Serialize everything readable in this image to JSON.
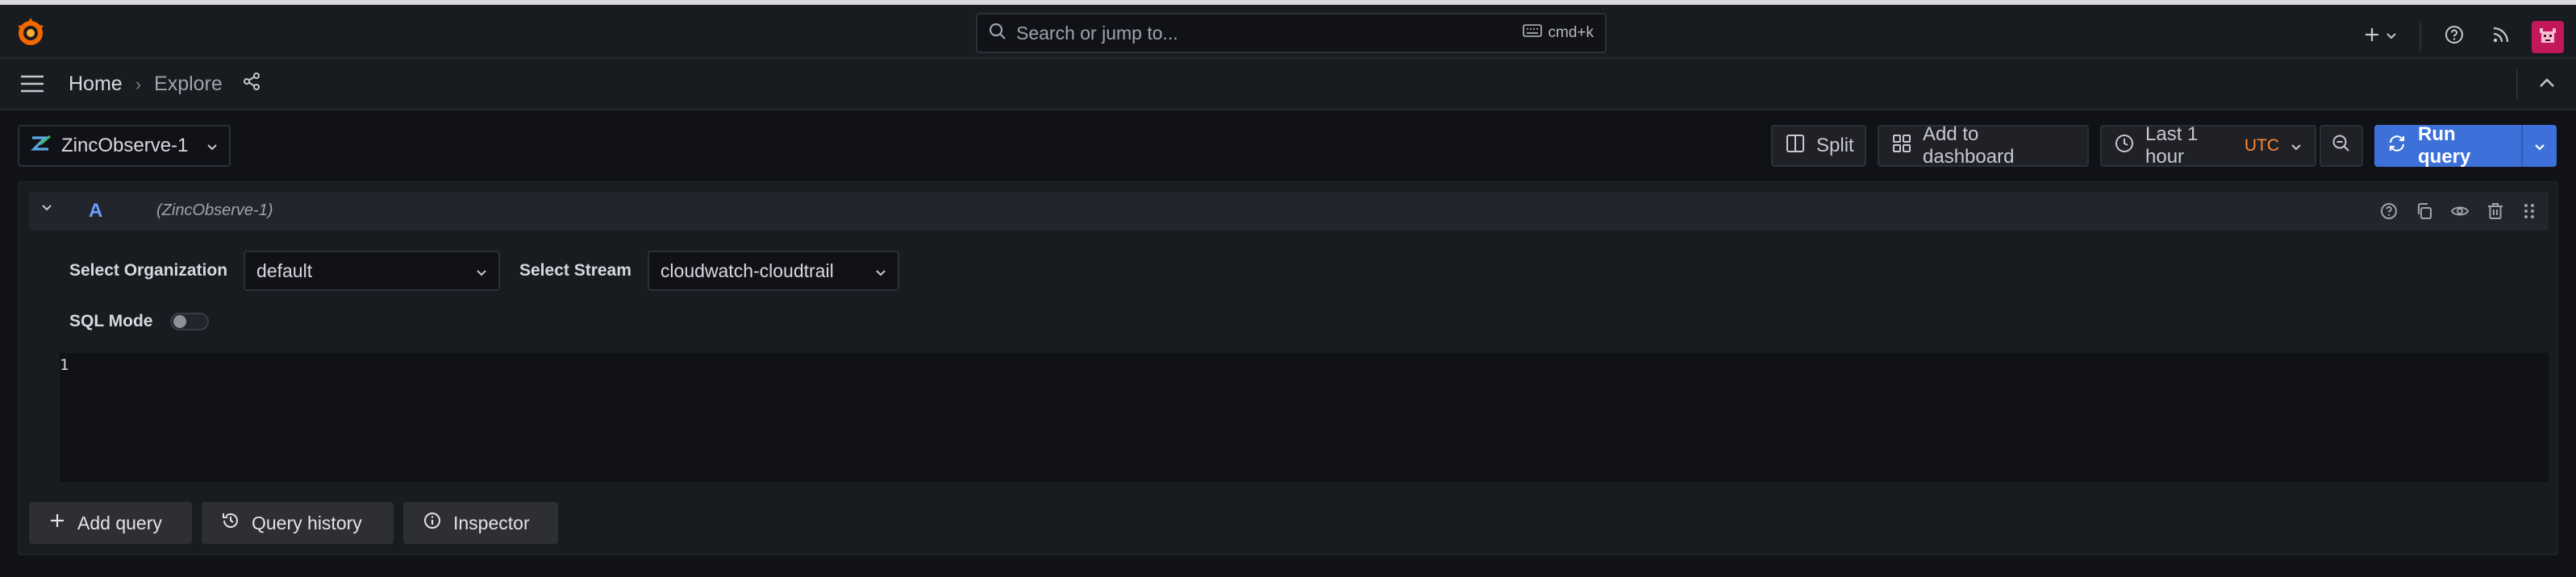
{
  "topbar": {
    "search_placeholder": "Search or jump to...",
    "search_shortcut": "cmd+k"
  },
  "breadcrumb": {
    "home": "Home",
    "separator": "›",
    "current": "Explore"
  },
  "toolbar": {
    "datasource": "ZincObserve-1",
    "split": "Split",
    "add_to_dashboard": "Add to dashboard",
    "time_range": "Last 1 hour",
    "timezone": "UTC",
    "run_query": "Run query"
  },
  "query": {
    "ref_id": "A",
    "datasource_label": "(ZincObserve-1)",
    "org_label": "Select Organization",
    "org_value": "default",
    "stream_label": "Select Stream",
    "stream_value": "cloudwatch-cloudtrail",
    "sql_mode_label": "SQL Mode",
    "sql_mode_on": false,
    "line_number": "1"
  },
  "footer": {
    "add_query": "Add query",
    "query_history": "Query history",
    "inspector": "Inspector"
  },
  "colors": {
    "accent": "#3d71d9",
    "utc": "#ff8833",
    "query_ref": "#6e9fff"
  }
}
